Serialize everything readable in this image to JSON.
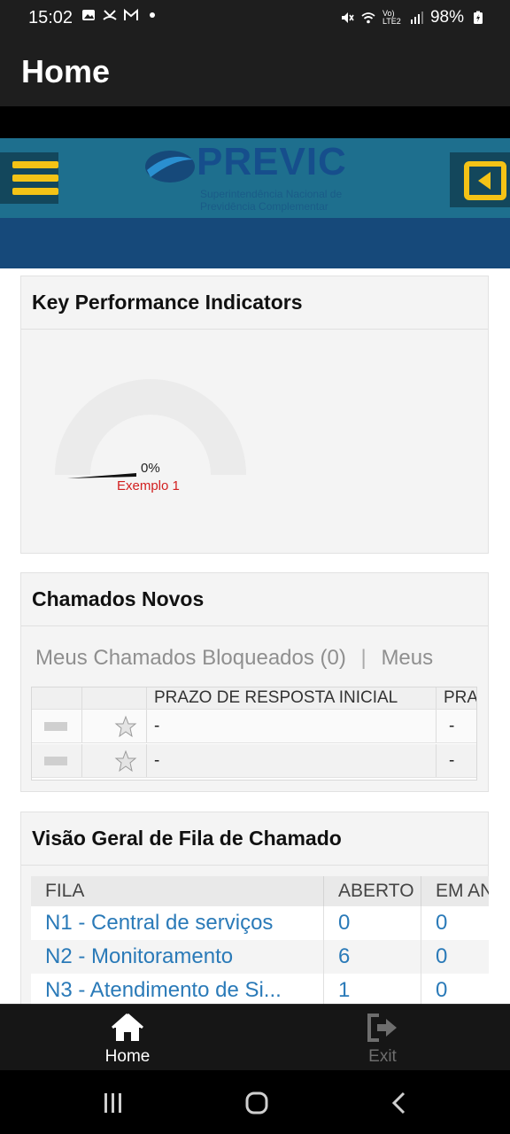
{
  "status_bar": {
    "time": "15:02",
    "battery": "98%",
    "network": "Vo) LTE2"
  },
  "app_bar": {
    "title": "Home"
  },
  "brand": {
    "logo_word": "PREVIC",
    "logo_sub1": "Superintendência Nacional de",
    "logo_sub2": "Previdência Complementar",
    "colors": {
      "header": "#1e6f8e",
      "header_dark": "#16497a",
      "accent": "#f4c316"
    }
  },
  "kpi": {
    "title": "Key Performance Indicators",
    "gauge_value_label": "0%",
    "gauge_value": 0,
    "gauge_name": "Exemplo 1"
  },
  "novos": {
    "title": "Chamados Novos",
    "tab_blocked": "Meus Chamados Bloqueados (0)",
    "tab_sep": "|",
    "tab_next": "Meus",
    "col_prazo": "PRAZO DE RESPOSTA INICIAL",
    "col_next": "PRA",
    "rows": [
      {
        "prazo": "-",
        "next": "-"
      },
      {
        "prazo": "-",
        "next": "-"
      }
    ]
  },
  "fila": {
    "title": "Visão Geral de Fila de Chamado",
    "columns": [
      "FILA",
      "ABERTO",
      "EM AN"
    ],
    "rows": [
      {
        "fila": "N1 - Central de serviços",
        "aberto": "0",
        "em": "0"
      },
      {
        "fila": "N2 - Monitoramento",
        "aberto": "6",
        "em": "0"
      },
      {
        "fila": "N3 - Atendimento de Si...",
        "aberto": "1",
        "em": "0"
      }
    ]
  },
  "bottom_nav": {
    "home": "Home",
    "exit": "Exit"
  },
  "icons": {
    "menu": "hamburger-icon",
    "back": "back-arrow-icon",
    "home": "home-icon",
    "exit": "exit-icon",
    "star": "star-icon"
  }
}
